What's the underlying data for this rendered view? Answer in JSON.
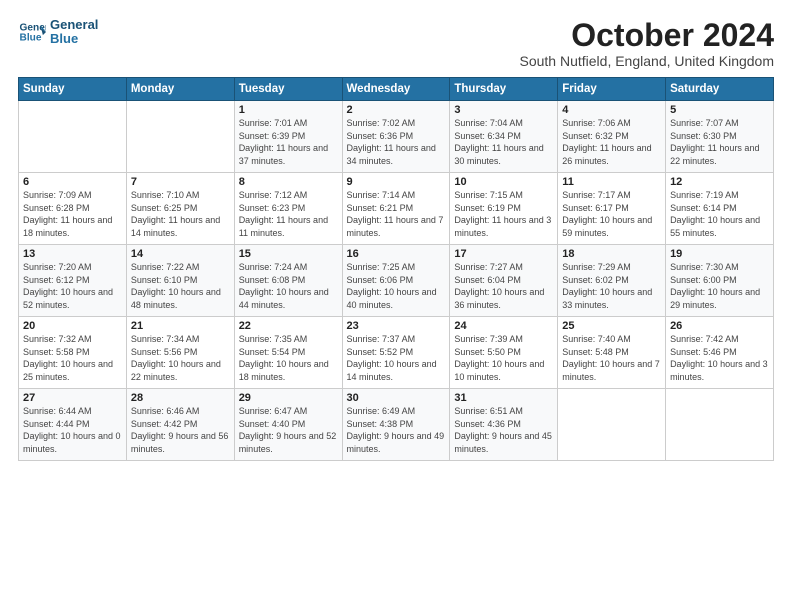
{
  "logo": {
    "line1": "General",
    "line2": "Blue"
  },
  "title": "October 2024",
  "location": "South Nutfield, England, United Kingdom",
  "weekdays": [
    "Sunday",
    "Monday",
    "Tuesday",
    "Wednesday",
    "Thursday",
    "Friday",
    "Saturday"
  ],
  "weeks": [
    [
      {
        "day": "",
        "info": ""
      },
      {
        "day": "",
        "info": ""
      },
      {
        "day": "1",
        "info": "Sunrise: 7:01 AM\nSunset: 6:39 PM\nDaylight: 11 hours and 37 minutes."
      },
      {
        "day": "2",
        "info": "Sunrise: 7:02 AM\nSunset: 6:36 PM\nDaylight: 11 hours and 34 minutes."
      },
      {
        "day": "3",
        "info": "Sunrise: 7:04 AM\nSunset: 6:34 PM\nDaylight: 11 hours and 30 minutes."
      },
      {
        "day": "4",
        "info": "Sunrise: 7:06 AM\nSunset: 6:32 PM\nDaylight: 11 hours and 26 minutes."
      },
      {
        "day": "5",
        "info": "Sunrise: 7:07 AM\nSunset: 6:30 PM\nDaylight: 11 hours and 22 minutes."
      }
    ],
    [
      {
        "day": "6",
        "info": "Sunrise: 7:09 AM\nSunset: 6:28 PM\nDaylight: 11 hours and 18 minutes."
      },
      {
        "day": "7",
        "info": "Sunrise: 7:10 AM\nSunset: 6:25 PM\nDaylight: 11 hours and 14 minutes."
      },
      {
        "day": "8",
        "info": "Sunrise: 7:12 AM\nSunset: 6:23 PM\nDaylight: 11 hours and 11 minutes."
      },
      {
        "day": "9",
        "info": "Sunrise: 7:14 AM\nSunset: 6:21 PM\nDaylight: 11 hours and 7 minutes."
      },
      {
        "day": "10",
        "info": "Sunrise: 7:15 AM\nSunset: 6:19 PM\nDaylight: 11 hours and 3 minutes."
      },
      {
        "day": "11",
        "info": "Sunrise: 7:17 AM\nSunset: 6:17 PM\nDaylight: 10 hours and 59 minutes."
      },
      {
        "day": "12",
        "info": "Sunrise: 7:19 AM\nSunset: 6:14 PM\nDaylight: 10 hours and 55 minutes."
      }
    ],
    [
      {
        "day": "13",
        "info": "Sunrise: 7:20 AM\nSunset: 6:12 PM\nDaylight: 10 hours and 52 minutes."
      },
      {
        "day": "14",
        "info": "Sunrise: 7:22 AM\nSunset: 6:10 PM\nDaylight: 10 hours and 48 minutes."
      },
      {
        "day": "15",
        "info": "Sunrise: 7:24 AM\nSunset: 6:08 PM\nDaylight: 10 hours and 44 minutes."
      },
      {
        "day": "16",
        "info": "Sunrise: 7:25 AM\nSunset: 6:06 PM\nDaylight: 10 hours and 40 minutes."
      },
      {
        "day": "17",
        "info": "Sunrise: 7:27 AM\nSunset: 6:04 PM\nDaylight: 10 hours and 36 minutes."
      },
      {
        "day": "18",
        "info": "Sunrise: 7:29 AM\nSunset: 6:02 PM\nDaylight: 10 hours and 33 minutes."
      },
      {
        "day": "19",
        "info": "Sunrise: 7:30 AM\nSunset: 6:00 PM\nDaylight: 10 hours and 29 minutes."
      }
    ],
    [
      {
        "day": "20",
        "info": "Sunrise: 7:32 AM\nSunset: 5:58 PM\nDaylight: 10 hours and 25 minutes."
      },
      {
        "day": "21",
        "info": "Sunrise: 7:34 AM\nSunset: 5:56 PM\nDaylight: 10 hours and 22 minutes."
      },
      {
        "day": "22",
        "info": "Sunrise: 7:35 AM\nSunset: 5:54 PM\nDaylight: 10 hours and 18 minutes."
      },
      {
        "day": "23",
        "info": "Sunrise: 7:37 AM\nSunset: 5:52 PM\nDaylight: 10 hours and 14 minutes."
      },
      {
        "day": "24",
        "info": "Sunrise: 7:39 AM\nSunset: 5:50 PM\nDaylight: 10 hours and 10 minutes."
      },
      {
        "day": "25",
        "info": "Sunrise: 7:40 AM\nSunset: 5:48 PM\nDaylight: 10 hours and 7 minutes."
      },
      {
        "day": "26",
        "info": "Sunrise: 7:42 AM\nSunset: 5:46 PM\nDaylight: 10 hours and 3 minutes."
      }
    ],
    [
      {
        "day": "27",
        "info": "Sunrise: 6:44 AM\nSunset: 4:44 PM\nDaylight: 10 hours and 0 minutes."
      },
      {
        "day": "28",
        "info": "Sunrise: 6:46 AM\nSunset: 4:42 PM\nDaylight: 9 hours and 56 minutes."
      },
      {
        "day": "29",
        "info": "Sunrise: 6:47 AM\nSunset: 4:40 PM\nDaylight: 9 hours and 52 minutes."
      },
      {
        "day": "30",
        "info": "Sunrise: 6:49 AM\nSunset: 4:38 PM\nDaylight: 9 hours and 49 minutes."
      },
      {
        "day": "31",
        "info": "Sunrise: 6:51 AM\nSunset: 4:36 PM\nDaylight: 9 hours and 45 minutes."
      },
      {
        "day": "",
        "info": ""
      },
      {
        "day": "",
        "info": ""
      }
    ]
  ]
}
